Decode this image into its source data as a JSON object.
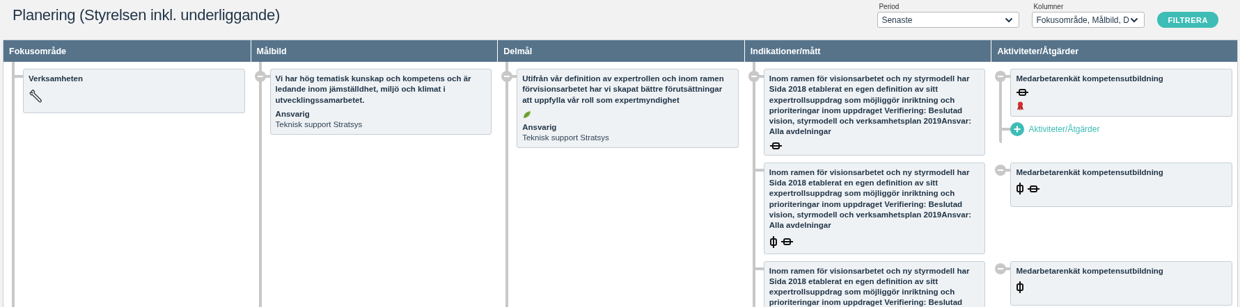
{
  "header": {
    "title": "Planering (Styrelsen inkl. underliggande)",
    "filters": [
      {
        "label": "Period",
        "value": "Senaste"
      },
      {
        "label": "Kolumner",
        "value": "Fokusområde, Målbild, D"
      }
    ],
    "button": "FILTRERA"
  },
  "columns": [
    "Fokusområde",
    "Målbild",
    "Delmål",
    "Indikationer/mått",
    "Aktiviteter/Åtgärder"
  ],
  "tree": [
    {
      "title": "Verksamheten",
      "icons": [
        {
          "kind": "wrench"
        }
      ],
      "expanded": true,
      "children": [
        {
          "title": "Vi har hög tematisk kunskap och kompetens och är ledande inom jämställdhet, miljö och klimat i utvecklingssamarbetet.",
          "responsible_label": "Ansvarig",
          "responsible": "Teknisk support Stratsys",
          "expanded": true,
          "children": [
            {
              "title": "Utifrån vår definition av expertrollen och inom ramen förvisionsarbetet har vi skapat bättre förutsättningar att uppfylla vår roll som expertmyndighet",
              "icons": [
                {
                  "kind": "leaf"
                }
              ],
              "responsible_label": "Ansvarig",
              "responsible": "Teknisk support Stratsys",
              "expanded": true,
              "children": [
                {
                  "title": "Inom ramen för visionsarbetet och ny styrmodell har Sida 2018 etablerat en egen definition av sitt expertrollsuppdrag som möjliggör inriktning och prioriteringar inom uppdraget Verifiering: Beslutad vision, styrmodell och verksamhetsplan 2019Ansvar: Alla avdelningar",
                  "icons": [
                    {
                      "kind": "link"
                    }
                  ],
                  "expanded": true,
                  "add_label": "Aktiviteter/Åtgärder",
                  "children": [
                    {
                      "title": "Medarbetarenkät kompetensutbildning",
                      "icons": [
                        {
                          "kind": "link"
                        },
                        {
                          "kind": "ribbon"
                        }
                      ],
                      "stacked_icons": true
                    }
                  ]
                },
                {
                  "title": "Inom ramen för visionsarbetet och ny styrmodell har Sida 2018 etablerat en egen definition av sitt expertrollsuppdrag som möjliggör inriktning och prioriteringar inom uppdraget Verifiering: Beslutad vision, styrmodell och verksamhetsplan 2019Ansvar: Alla avdelningar",
                  "icons": [
                    {
                      "kind": "candle"
                    },
                    {
                      "kind": "link"
                    }
                  ],
                  "expanded": true,
                  "children": [
                    {
                      "title": "Medarbetarenkät kompetensutbildning",
                      "icons": [
                        {
                          "kind": "candle"
                        },
                        {
                          "kind": "link"
                        }
                      ]
                    }
                  ]
                },
                {
                  "title": "Inom ramen för visionsarbetet och ny styrmodell har Sida 2018 etablerat en egen definition av sitt expertrollsuppdrag som möjliggör inriktning och prioriteringar inom uppdraget Verifiering: Beslutad",
                  "expanded": true,
                  "children": [
                    {
                      "title": "Medarbetarenkät kompetensutbildning",
                      "icons": [
                        {
                          "kind": "candle"
                        }
                      ]
                    }
                  ]
                }
              ]
            }
          ]
        }
      ]
    }
  ]
}
